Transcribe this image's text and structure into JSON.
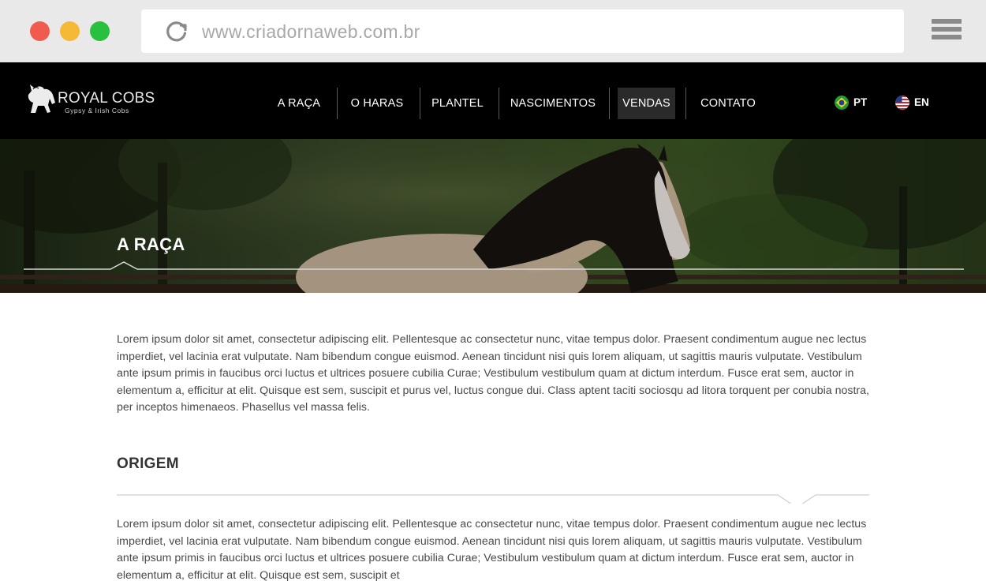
{
  "browser": {
    "url": "www.criadornaweb.com.br"
  },
  "brand": {
    "title": "ROYAL COBS",
    "subtitle": "Gypsy & Irish Cobs"
  },
  "nav": {
    "items": [
      {
        "label": "A RAÇA"
      },
      {
        "label": "O HARAS"
      },
      {
        "label": "PLANTEL"
      },
      {
        "label": "NASCIMENTOS"
      },
      {
        "label": "VENDAS",
        "active": true
      },
      {
        "label": "CONTATO"
      }
    ]
  },
  "languages": [
    {
      "label": "PT",
      "icon": "brazil-flag-icon"
    },
    {
      "label": "EN",
      "icon": "usa-flag-icon"
    }
  ],
  "hero": {
    "title": "A RAÇA"
  },
  "content": {
    "intro": "Lorem ipsum dolor sit amet, consectetur adipiscing elit. Pellentesque ac consectetur nunc, vitae tempus dolor. Praesent condimentum augue nec lectus imperdiet, vel lacinia erat vulputate. Nam bibendum congue euismod. Aenean tincidunt nisi quis lorem aliquam, ut sagittis mauris vulputate. Vestibulum ante ipsum primis in faucibus orci luctus et ultrices posuere cubilia Curae; Vestibulum vestibulum quam at dictum interdum. Fusce erat sem, auctor in elementum a, efficitur at elit. Quisque est sem, suscipit et purus vel, luctus congue dui. Class aptent taciti sociosqu ad litora torquent per conubia nostra, per inceptos himenaeos. Phasellus vel massa felis.",
    "section_title": "ORIGEM",
    "section_text": "Lorem ipsum dolor sit amet, consectetur adipiscing elit. Pellentesque ac consectetur nunc, vitae tempus dolor. Praesent condimentum augue nec lectus imperdiet, vel lacinia erat vulputate. Nam bibendum congue euismod. Aenean tincidunt nisi quis lorem aliquam, ut sagittis mauris vulputate. Vestibulum ante ipsum primis in faucibus orci luctus et ultrices posuere cubilia Curae; Vestibulum vestibulum quam at dictum interdum. Fusce erat sem, auctor in elementum a, efficitur at elit. Quisque est sem, suscipit et"
  },
  "colors": {
    "close_dot": "#f05a4f",
    "minimize_dot": "#f5b935",
    "maximize_dot": "#27c03f",
    "header_bg": "#000000",
    "active_nav_bg": "#2a2a2a"
  }
}
